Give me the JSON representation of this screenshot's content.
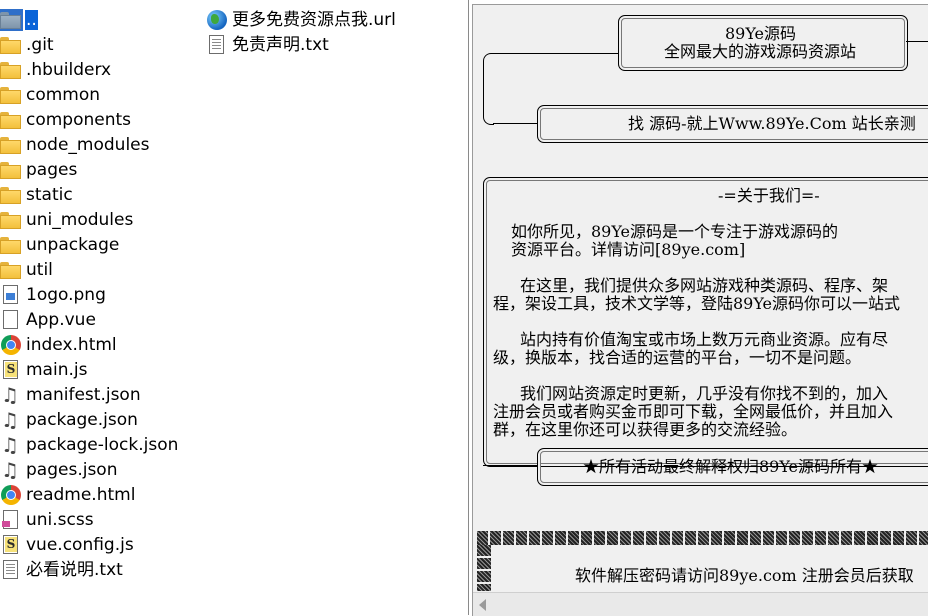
{
  "file_list": {
    "column1": [
      {
        "name": "..",
        "icon": "folder-up-icon",
        "selected": true
      },
      {
        "name": ".git",
        "icon": "folder-icon"
      },
      {
        "name": ".hbuilderx",
        "icon": "folder-icon"
      },
      {
        "name": "common",
        "icon": "folder-icon"
      },
      {
        "name": "components",
        "icon": "folder-icon"
      },
      {
        "name": "node_modules",
        "icon": "folder-icon"
      },
      {
        "name": "pages",
        "icon": "folder-icon"
      },
      {
        "name": "static",
        "icon": "folder-icon"
      },
      {
        "name": "uni_modules",
        "icon": "folder-icon"
      },
      {
        "name": "unpackage",
        "icon": "folder-icon"
      },
      {
        "name": "util",
        "icon": "folder-icon"
      },
      {
        "name": "1ogo.png",
        "icon": "image-file-icon"
      },
      {
        "name": "App.vue",
        "icon": "document-icon"
      },
      {
        "name": "index.html",
        "icon": "chrome-icon"
      },
      {
        "name": "main.js",
        "icon": "js-file-icon"
      },
      {
        "name": "manifest.json",
        "icon": "json-file-icon"
      },
      {
        "name": "package.json",
        "icon": "json-file-icon"
      },
      {
        "name": "package-lock.json",
        "icon": "json-file-icon"
      },
      {
        "name": "pages.json",
        "icon": "json-file-icon"
      },
      {
        "name": "readme.html",
        "icon": "chrome-icon"
      },
      {
        "name": "uni.scss",
        "icon": "css-file-icon"
      },
      {
        "name": "vue.config.js",
        "icon": "js-file-icon"
      },
      {
        "name": "必看说明.txt",
        "icon": "text-file-icon"
      }
    ],
    "column2": [
      {
        "name": "更多免费资源点我.url",
        "icon": "globe-icon"
      },
      {
        "name": "免责声明.txt",
        "icon": "text-file-icon"
      }
    ]
  },
  "preview": {
    "header_box": {
      "line1": "89Ye源码",
      "line2": "全网最大的游戏源码资源站"
    },
    "slogan_box": {
      "text": "找 源码-就上Www.89Ye.Com 站长亲测"
    },
    "about": {
      "title": "-=关于我们=-",
      "para1": [
        "如你所见，89Ye源码是一个专注于游戏源码的",
        "资源平台。详情访问[89ye.com]"
      ],
      "para2": [
        "在这里，我们提供众多网站游戏种类源码、程序、架",
        "程，架设工具，技术文学等，登陆89Ye源码你可以一站式"
      ],
      "para3": [
        "站内持有价值淘宝或市场上数万元商业资源。应有尽",
        "级，换版本，找合适的运营的平台，一切不是问题。"
      ],
      "para4": [
        "我们网站资源定时更新，几乎没有你找不到的，加入",
        "注册会员或者购买金币即可下载，全网最低价，并且加入",
        "群，在这里你还可以获得更多的交流经验。"
      ]
    },
    "footer_box": {
      "text": "★所有活动最终解释权归89Ye源码所有★"
    },
    "bottom_note": "软件解压密码请访问89ye.com 注册会员后获取"
  }
}
